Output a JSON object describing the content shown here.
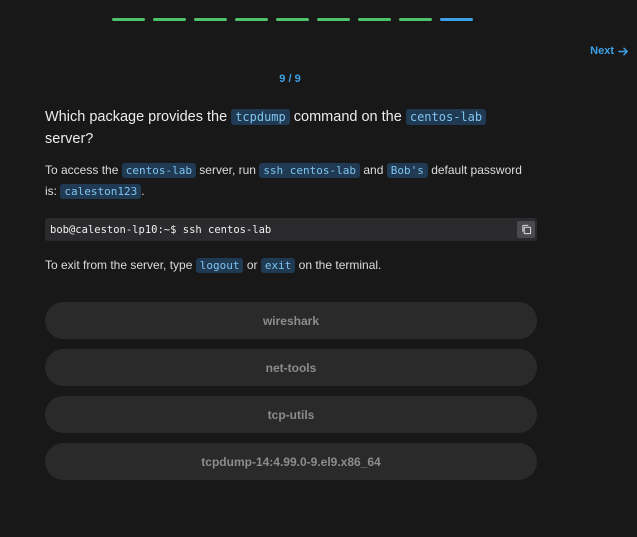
{
  "progress": {
    "total": 9,
    "completed": 8,
    "current": 9,
    "colors": {
      "done": "#4fc36b",
      "current": "#3ea0e6"
    }
  },
  "nav": {
    "next_label": "Next",
    "next_icon": "arrow-right-icon"
  },
  "counter": "9 / 9",
  "question": {
    "pre": "Which package provides the ",
    "code1": "tcpdump",
    "mid": " command on the ",
    "code2": "centos-lab",
    "post": " server?"
  },
  "instructions": {
    "t1": "To access the ",
    "c1": "centos-lab",
    "t2": " server, run ",
    "c2": "ssh centos-lab",
    "t3": " and ",
    "c3": "Bob's",
    "t4": " default password is: ",
    "c4": "caleston123",
    "t5": "."
  },
  "terminal": {
    "command": "bob@caleston-lp10:~$ ssh centos-lab",
    "copy_icon": "copy-icon"
  },
  "exit": {
    "t1": "To exit from the server, type ",
    "c1": "logout",
    "t2": " or ",
    "c2": "exit",
    "t3": " on the terminal."
  },
  "options": [
    {
      "label": "wireshark"
    },
    {
      "label": "net-tools"
    },
    {
      "label": "tcp-utils"
    },
    {
      "label": "tcpdump-14:4.99.0-9.el9.x86_64"
    }
  ]
}
